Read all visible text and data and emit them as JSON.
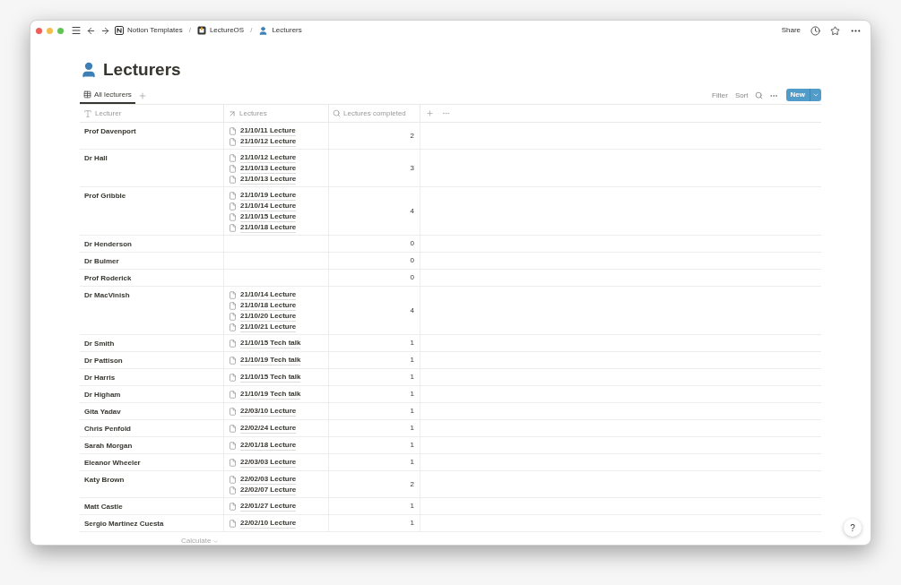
{
  "window": {
    "breadcrumbs": [
      {
        "label": "Notion Templates",
        "kind": "notion"
      },
      {
        "label": "LectureOS",
        "kind": "workspace"
      },
      {
        "label": "Lecturers",
        "kind": "person"
      }
    ],
    "separator": "/",
    "share": "Share"
  },
  "page": {
    "title": "Lecturers"
  },
  "views": [
    {
      "label": "All lecturers",
      "selected": true
    }
  ],
  "toolbar": {
    "filter": "Filter",
    "sort": "Sort",
    "new": "New"
  },
  "table": {
    "columns": [
      {
        "label": "Lecturer",
        "kind": "title"
      },
      {
        "label": "Lectures",
        "kind": "relation"
      },
      {
        "label": "Lectures completed",
        "kind": "rollup"
      }
    ],
    "rows": [
      {
        "lecturer": "Prof Davenport",
        "lectures": [
          "21/10/11 Lecture",
          "21/10/12 Lecture"
        ],
        "completed": "2"
      },
      {
        "lecturer": "Dr Hall",
        "lectures": [
          "21/10/12 Lecture",
          "21/10/13 Lecture",
          "21/10/13 Lecture"
        ],
        "completed": "3"
      },
      {
        "lecturer": "Prof Gribble",
        "lectures": [
          "21/10/19 Lecture",
          "21/10/14 Lecture",
          "21/10/15 Lecture",
          "21/10/18 Lecture"
        ],
        "completed": "4"
      },
      {
        "lecturer": "Dr Henderson",
        "lectures": [],
        "completed": "0"
      },
      {
        "lecturer": "Dr Bulmer",
        "lectures": [],
        "completed": "0"
      },
      {
        "lecturer": "Prof Roderick",
        "lectures": [],
        "completed": "0"
      },
      {
        "lecturer": "Dr MacVinish",
        "lectures": [
          "21/10/14 Lecture",
          "21/10/18 Lecture",
          "21/10/20 Lecture",
          "21/10/21 Lecture"
        ],
        "completed": "4"
      },
      {
        "lecturer": "Dr Smith",
        "lectures": [
          "21/10/15 Tech talk"
        ],
        "completed": "1"
      },
      {
        "lecturer": "Dr Pattison",
        "lectures": [
          "21/10/19 Tech talk"
        ],
        "completed": "1"
      },
      {
        "lecturer": "Dr Harris",
        "lectures": [
          "21/10/15 Tech talk"
        ],
        "completed": "1"
      },
      {
        "lecturer": "Dr Higham",
        "lectures": [
          "21/10/19 Tech talk"
        ],
        "completed": "1"
      },
      {
        "lecturer": "Gita Yadav",
        "lectures": [
          "22/03/10 Lecture"
        ],
        "completed": "1"
      },
      {
        "lecturer": "Chris Penfold",
        "lectures": [
          "22/02/24 Lecture"
        ],
        "completed": "1"
      },
      {
        "lecturer": "Sarah Morgan",
        "lectures": [
          "22/01/18 Lecture"
        ],
        "completed": "1"
      },
      {
        "lecturer": "Eleanor Wheeler",
        "lectures": [
          "22/03/03 Lecture"
        ],
        "completed": "1"
      },
      {
        "lecturer": "Katy Brown",
        "lectures": [
          "22/02/03 Lecture",
          "22/02/07 Lecture"
        ],
        "completed": "2"
      },
      {
        "lecturer": "Matt Castle",
        "lectures": [
          "22/01/27 Lecture"
        ],
        "completed": "1"
      },
      {
        "lecturer": "Sergio Martinez Cuesta",
        "lectures": [
          "22/02/10 Lecture"
        ],
        "completed": "1"
      }
    ],
    "footer": "Calculate"
  },
  "help": "?"
}
